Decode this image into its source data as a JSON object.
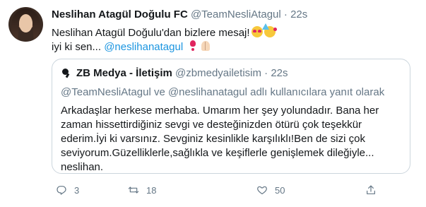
{
  "tweet": {
    "display_name": "Neslihan Atagül Doğulu FC",
    "handle": "@TeamNesliAtagul",
    "separator": "·",
    "time": "22s",
    "line1": "Neslihan Atagül Doğulu'dan bizlere mesaj!",
    "line2_prefix": "iyi ki sen... ",
    "mention": "@neslihanatagul",
    "emojis": [
      "smiling-face-with-heart-eyes",
      "partying-face",
      "heart-exclamation",
      "folded-hands"
    ]
  },
  "quote": {
    "display_name": "ZB Medya - İletişim",
    "handle": "@zbmedyailetisim",
    "separator": "·",
    "time": "22s",
    "reply_context": "@TeamNesliAtagul ve @neslihanatagul adlı kullanıcılara yanıt olarak",
    "text": "Arkadaşlar herkese merhaba. Umarım her şey yolundadır. Bana her zaman hissettirdiğiniz sevgi ve desteğinizden ötürü çok teşekkür ederim.İyi ki varsınız. Sevginiz kesinlikle karşılıklı!Ben de sizi çok seviyorum.Güzelliklerle,sağlıkla ve keşiflerle genişlemek dileğiyle... neslihan."
  },
  "actions": {
    "reply_count": "3",
    "retweet_count": "18",
    "like_count": "50"
  },
  "colors": {
    "link": "#1b95e0",
    "secondary_text": "#657786",
    "border": "#ccd6dd"
  }
}
